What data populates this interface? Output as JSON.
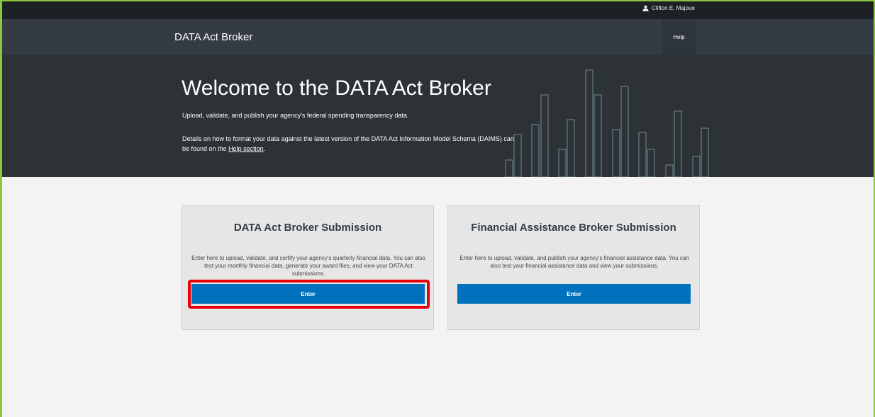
{
  "topbar": {
    "user_name": "Clifton E. Majoue",
    "user_icon": "user-icon"
  },
  "navbar": {
    "brand": "DATA Act Broker",
    "help": "Help"
  },
  "hero": {
    "title": "Welcome to the DATA Act Broker",
    "subtitle": "Upload, validate, and publish your agency's federal spending transparency data.",
    "details_prefix": "Details on how to format your data against the latest version of the DATA Act Information Model Schema (DAIMS) can be found on the ",
    "details_link": "Help section",
    "details_suffix": "."
  },
  "cards": [
    {
      "title": "DATA Act Broker Submission",
      "description": "Enter here to upload, validate, and certify your agency's quarterly financial data. You can also test your monthly financial data, generate your award files, and view your DATA Act submissions.",
      "button": "Enter",
      "highlighted": true
    },
    {
      "title": "Financial Assistance Broker Submission",
      "description": "Enter here to upload, validate, and publish your agency's financial assistance data. You can also test your financial assistance data and view your submissions.",
      "button": "Enter",
      "highlighted": false
    }
  ],
  "colors": {
    "accent": "#0071bc",
    "highlight": "#e8000b",
    "hero_bg": "#2d3237",
    "navbar_bg": "#343b44"
  }
}
